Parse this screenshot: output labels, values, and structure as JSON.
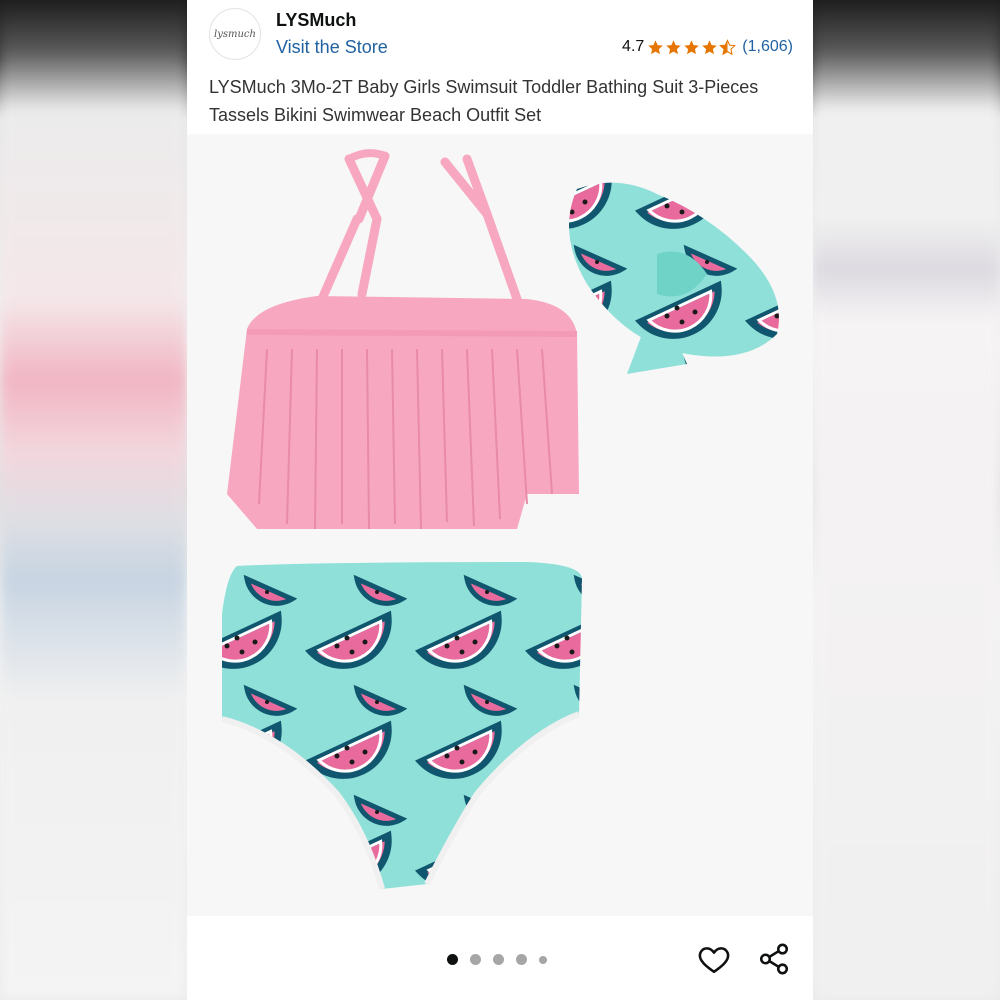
{
  "store": {
    "logo_text": "lysmuch",
    "name": "LYSMuch",
    "visit_label": "Visit the Store"
  },
  "rating": {
    "value": "4.7",
    "stars": 4.5,
    "review_count": "(1,606)",
    "star_color": "#e77600"
  },
  "product": {
    "title": "LYSMuch 3Mo-2T Baby Girls Swimsuit Toddler Bathing Suit 3-Pieces Tassels Bikini Swimwear Beach Outfit Set"
  },
  "image": {
    "description_icon": "product-photo"
  },
  "carousel": {
    "total_dots": 5,
    "active_index": 0
  },
  "actions": {
    "favorite_icon": "heart-icon",
    "share_icon": "share-icon"
  },
  "colors": {
    "link": "#2162a1",
    "pink": "#f7a8c0",
    "mint": "#8fe0d8"
  }
}
